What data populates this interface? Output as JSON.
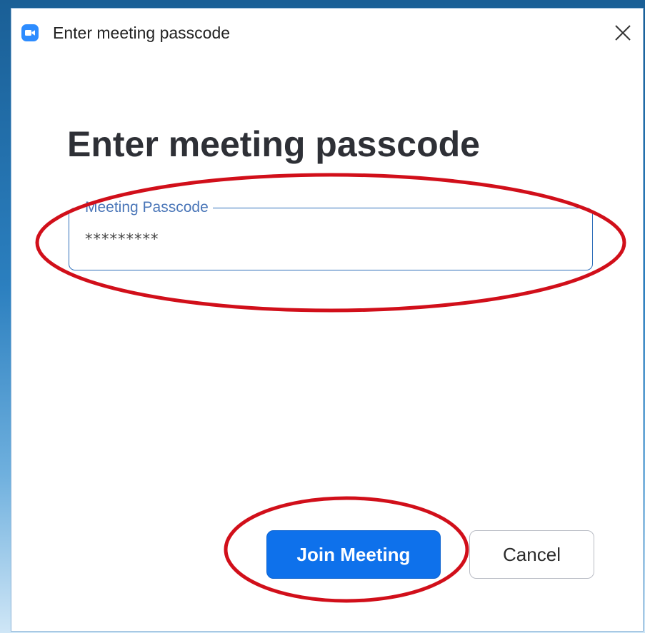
{
  "window": {
    "title": "Enter meeting passcode",
    "app_icon": "zoom-camera-icon",
    "close_icon": "close-icon"
  },
  "dialog": {
    "heading": "Enter meeting passcode",
    "passcode_field": {
      "label": "Meeting Passcode",
      "value": "*********"
    },
    "buttons": {
      "join_label": "Join Meeting",
      "cancel_label": "Cancel"
    }
  },
  "colors": {
    "accent": "#0e71eb",
    "field_border": "#2f6fba",
    "field_label": "#4a76b8",
    "annotation": "#d10f1a"
  }
}
